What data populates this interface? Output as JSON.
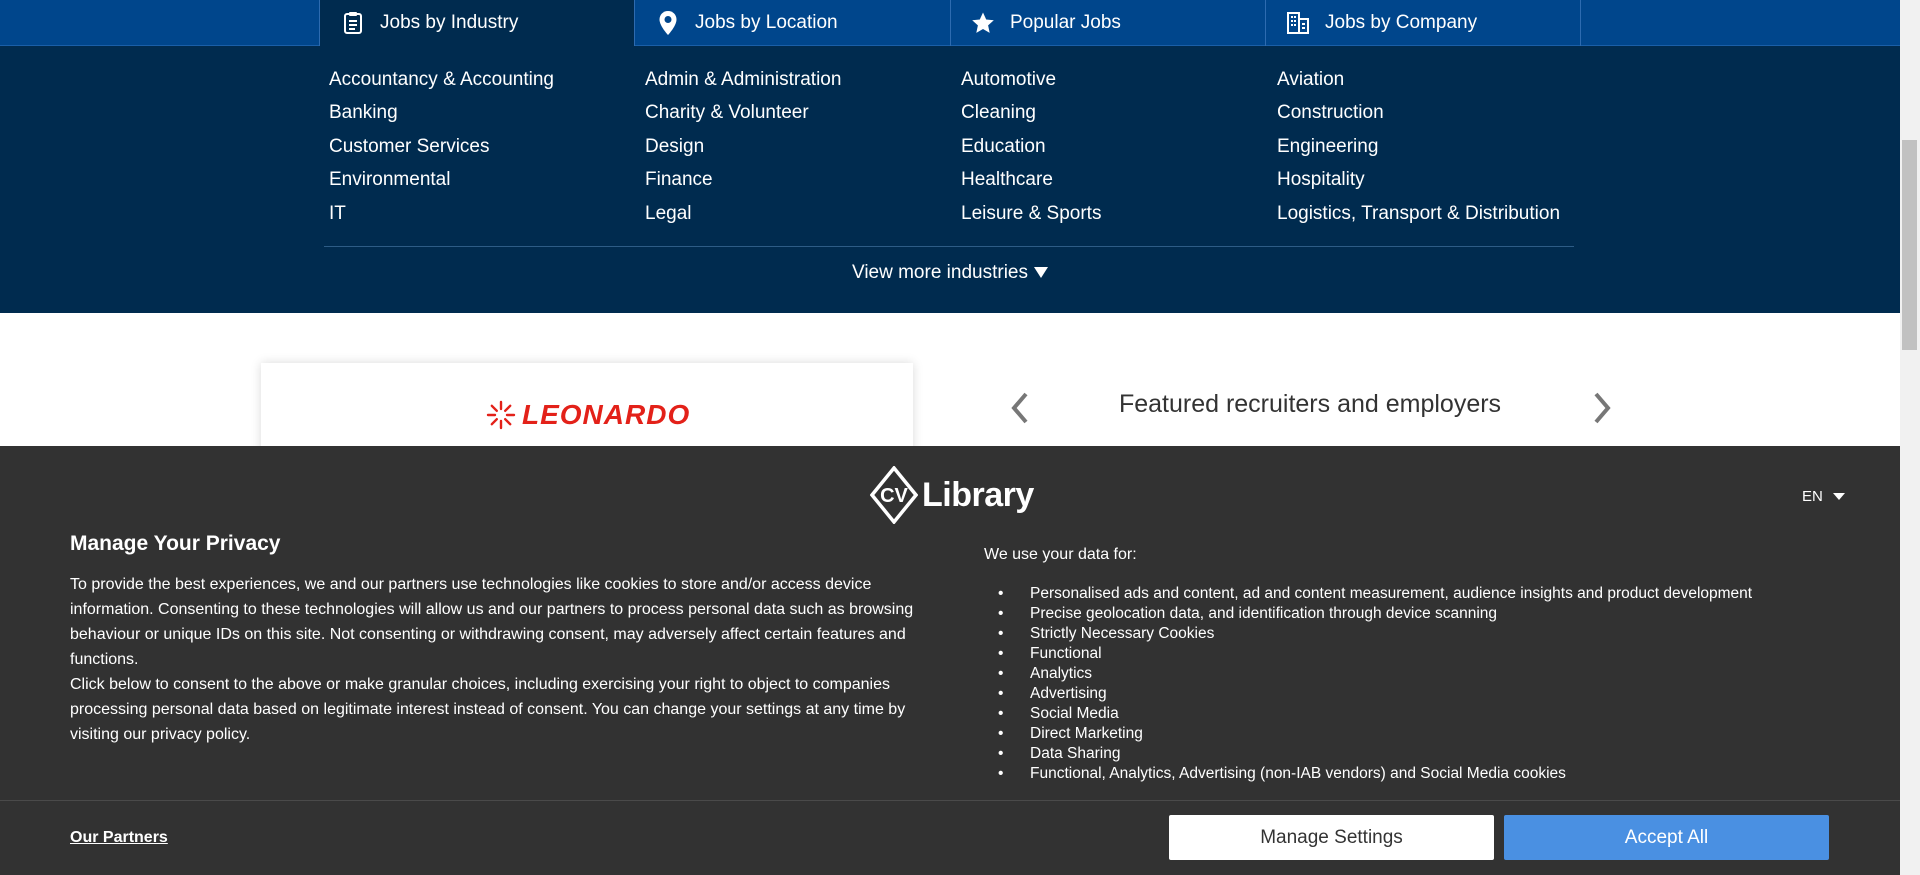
{
  "tabs": [
    {
      "label": "Jobs by Industry",
      "icon": "clipboard-icon",
      "active": true
    },
    {
      "label": "Jobs by Location",
      "icon": "map-pin-icon",
      "active": false
    },
    {
      "label": "Popular Jobs",
      "icon": "star-icon",
      "active": false
    },
    {
      "label": "Jobs by Company",
      "icon": "building-icon",
      "active": false
    }
  ],
  "industries": [
    "Accountancy & Accounting",
    "Admin & Administration",
    "Automotive",
    "Aviation",
    "Banking",
    "Charity & Volunteer",
    "Cleaning",
    "Construction",
    "Customer Services",
    "Design",
    "Education",
    "Engineering",
    "Environmental",
    "Finance",
    "Healthcare",
    "Hospitality",
    "IT",
    "Legal",
    "Leisure & Sports",
    "Logistics, Transport & Distribution"
  ],
  "view_more_label": "View more industries",
  "featured": {
    "title": "Featured recruiters and employers",
    "logo_text": "LEONARDO"
  },
  "privacy": {
    "brand_text": "Library",
    "language": "EN",
    "title": "Manage Your Privacy",
    "para1": "To provide the best experiences, we and our partners use technologies like cookies to store and/or access device information. Consenting to these technologies will allow us and our partners to process personal data such as browsing behaviour or unique IDs on this site. Not consenting or withdrawing consent, may adversely affect certain features and functions.",
    "para2": "Click below to consent to the above or make granular choices, including exercising your right to object to companies processing personal data based on legitimate interest instead of consent. You can change your settings at any time by visiting our privacy policy.",
    "uses_title": "We use your data for:",
    "uses": [
      "Personalised ads and content, ad and content measurement, audience insights and product development",
      "Precise geolocation data, and identification through device scanning",
      "Strictly Necessary Cookies",
      "Functional",
      "Analytics",
      "Advertising",
      "Social Media",
      "Direct Marketing",
      "Data Sharing",
      "Functional, Analytics, Advertising (non-IAB vendors) and Social Media cookies"
    ],
    "partners_label": "Our Partners",
    "manage_label": "Manage Settings",
    "accept_label": "Accept All"
  },
  "colors": {
    "tab_bar": "#00468c",
    "panel": "#002b4f",
    "overlay": "#323232",
    "accept": "#4a90e2",
    "brand_red": "#e32119"
  }
}
